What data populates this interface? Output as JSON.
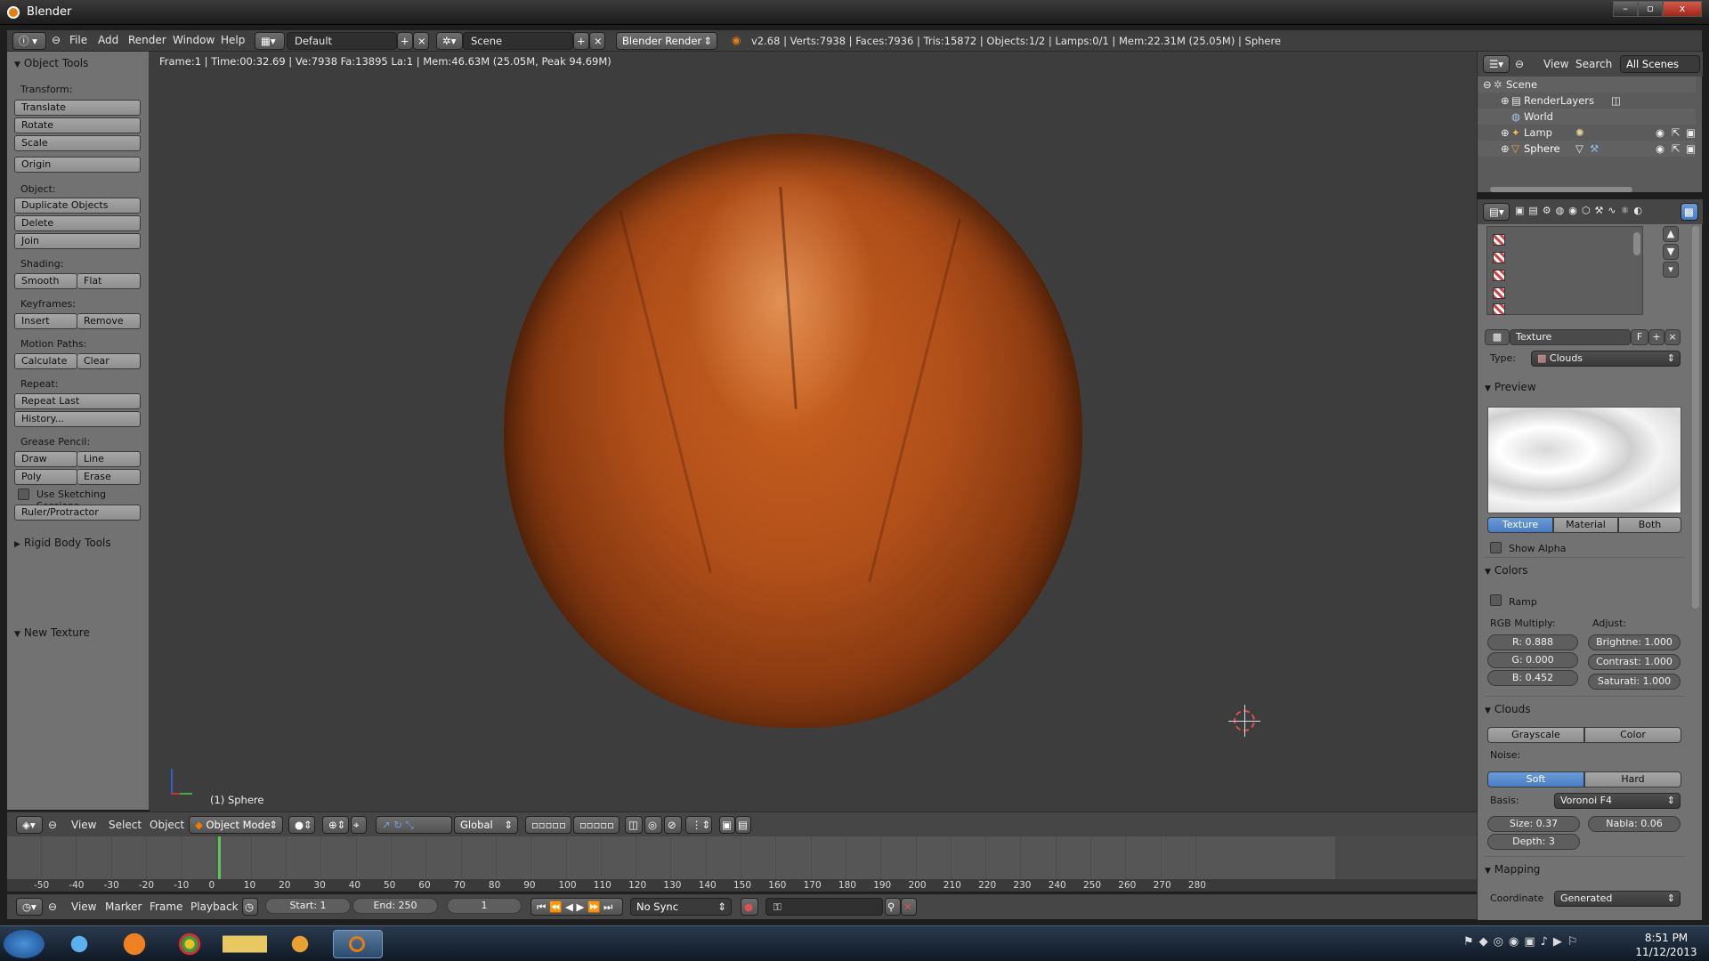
{
  "window": {
    "title": "Blender",
    "buttons": [
      "–",
      "▫",
      "x"
    ]
  },
  "info_header": {
    "menus": [
      "File",
      "Add",
      "Render",
      "Window",
      "Help"
    ],
    "layout": "Default",
    "scene": "Scene",
    "engine": "Blender Render",
    "stats": "v2.68 | Verts:7938 | Faces:7936 | Tris:15872 | Objects:1/2 | Lamps:0/1 | Mem:22.31M (25.05M) | Sphere"
  },
  "tool_shelf": {
    "panel_title": "Object Tools",
    "sections": {
      "transform": "Transform:",
      "object": "Object:",
      "shading": "Shading:",
      "keyframes": "Keyframes:",
      "motion_paths": "Motion Paths:",
      "repeat": "Repeat:",
      "grease_pencil": "Grease Pencil:"
    },
    "buttons": {
      "translate": "Translate",
      "rotate": "Rotate",
      "scale": "Scale",
      "origin": "Origin",
      "duplicate": "Duplicate Objects",
      "delete": "Delete",
      "join": "Join",
      "smooth": "Smooth",
      "flat": "Flat",
      "insert": "Insert",
      "remove": "Remove",
      "calculate": "Calculate",
      "clear": "Clear",
      "repeat_last": "Repeat Last",
      "history": "History...",
      "draw": "Draw",
      "line": "Line",
      "poly": "Poly",
      "erase": "Erase",
      "ruler": "Ruler/Protractor"
    },
    "sketching_label": "Use Sketching Sessions",
    "rigid_body": "Rigid Body Tools",
    "new_texture": "New Texture"
  },
  "viewport": {
    "info": "Frame:1 | Time:00:32.69 | Ve:7938 Fa:13895 La:1 | Mem:46.63M (25.05M, Peak 94.69M)",
    "object_label": "(1) Sphere",
    "header": {
      "view": "View",
      "select": "Select",
      "object": "Object",
      "mode": "Object Mode",
      "orientation": "Global"
    }
  },
  "timeline": {
    "ticks": [
      "-50",
      "-40",
      "-30",
      "-20",
      "-10",
      "0",
      "10",
      "20",
      "30",
      "40",
      "50",
      "60",
      "70",
      "80",
      "90",
      "100",
      "110",
      "120",
      "130",
      "140",
      "150",
      "160",
      "170",
      "180",
      "190",
      "200",
      "210",
      "220",
      "230",
      "240",
      "250",
      "260",
      "270",
      "280"
    ],
    "current_frame": 1,
    "header": {
      "view": "View",
      "marker": "Marker",
      "frame": "Frame",
      "playback": "Playback",
      "start": "Start: 1",
      "end": "End: 250",
      "frame_field": "1",
      "sync": "No Sync"
    }
  },
  "outliner": {
    "menus": [
      "View",
      "Search"
    ],
    "filter": "All Scenes",
    "rows": [
      "Scene",
      "RenderLayers",
      "World",
      "Lamp",
      "Sphere"
    ]
  },
  "properties": {
    "texture_name": "Texture",
    "fake_user": "F",
    "type_label": "Type:",
    "type_value": "Clouds",
    "preview_title": "Preview",
    "preview_tabs": [
      "Texture",
      "Material",
      "Both"
    ],
    "show_alpha": "Show Alpha",
    "colors_title": "Colors",
    "ramp": "Ramp",
    "rgb_multiply": "RGB Multiply:",
    "adjust": "Adjust:",
    "r": "R: 0.888",
    "g": "G: 0.000",
    "b": "B: 0.452",
    "brightness": "Brightne: 1.000",
    "contrast": "Contrast: 1.000",
    "saturation": "Saturati: 1.000",
    "clouds_title": "Clouds",
    "clouds_tabs": [
      "Grayscale",
      "Color"
    ],
    "noise_label": "Noise:",
    "noise_tabs": [
      "Soft",
      "Hard"
    ],
    "basis_label": "Basis:",
    "basis_value": "Voronoi F4",
    "size": "Size: 0.37",
    "nabla": "Nabla: 0.06",
    "depth": "Depth: 3",
    "mapping_title": "Mapping",
    "coordinate_label": "Coordinate",
    "coordinate_value": "Generated"
  },
  "taskbar": {
    "time": "8:51 PM",
    "date": "11/12/2013"
  },
  "colors": {
    "accent": "#e87d0d",
    "selected": "#5680c2",
    "sphere": "#b2501a",
    "frame_line": "#5dc455"
  }
}
